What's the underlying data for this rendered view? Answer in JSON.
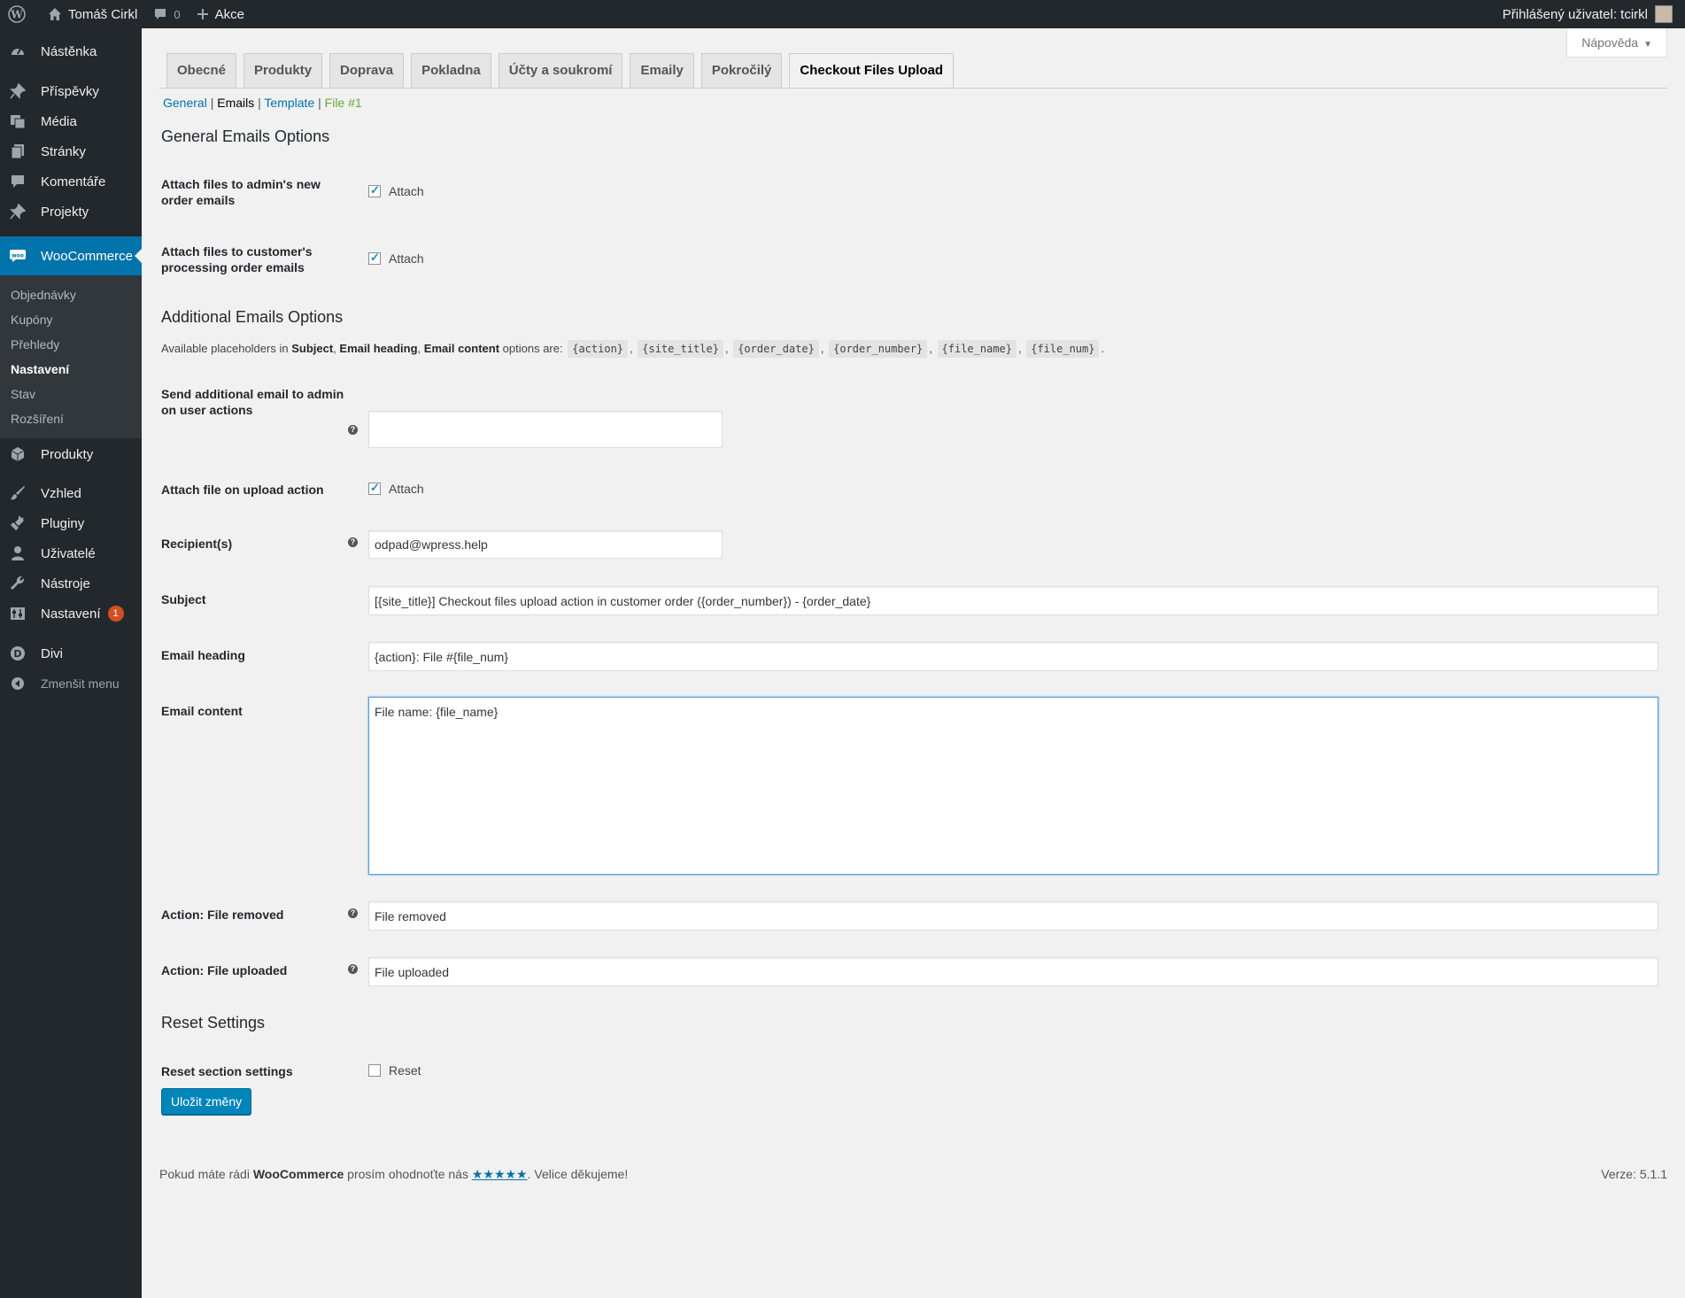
{
  "adminbar": {
    "site_name": "Tomáš Cirkl",
    "comments_count": "0",
    "new_label": "Akce",
    "user_greeting": "Přihlášený uživatel: tcirkl"
  },
  "sidebar": {
    "items": [
      {
        "label": "Nástěnka",
        "icon": "dashboard-icon"
      },
      {
        "label": "Příspěvky",
        "icon": "pin-icon"
      },
      {
        "label": "Média",
        "icon": "media-icon"
      },
      {
        "label": "Stránky",
        "icon": "pages-icon"
      },
      {
        "label": "Komentáře",
        "icon": "comment-icon"
      },
      {
        "label": "Projekty",
        "icon": "pin-icon"
      },
      {
        "label": "WooCommerce",
        "icon": "woo-icon"
      },
      {
        "label": "Produkty",
        "icon": "box-icon"
      },
      {
        "label": "Vzhled",
        "icon": "brush-icon"
      },
      {
        "label": "Pluginy",
        "icon": "plugin-icon"
      },
      {
        "label": "Uživatelé",
        "icon": "user-icon"
      },
      {
        "label": "Nástroje",
        "icon": "wrench-icon"
      },
      {
        "label": "Nastavení",
        "icon": "settings-icon",
        "badge": "1"
      },
      {
        "label": "Divi",
        "icon": "divi-icon"
      },
      {
        "label": "Zmenšit menu",
        "icon": "collapse-icon"
      }
    ],
    "woo_submenu": [
      "Objednávky",
      "Kupóny",
      "Přehledy",
      "Nastavení",
      "Stav",
      "Rozšíření"
    ]
  },
  "help_tab": "Nápověda",
  "tabs": [
    "Obecné",
    "Produkty",
    "Doprava",
    "Pokladna",
    "Účty a soukromí",
    "Emaily",
    "Pokročilý",
    "Checkout Files Upload"
  ],
  "subnav": {
    "general": "General",
    "emails": "Emails",
    "template": "Template",
    "file1": "File #1"
  },
  "sections": {
    "general": "General Emails Options",
    "additional": "Additional Emails Options",
    "reset": "Reset Settings"
  },
  "fields": {
    "attach_admin": {
      "label": "Attach files to admin's new order emails",
      "option": "Attach",
      "checked": true
    },
    "attach_customer": {
      "label": "Attach files to customer's processing order emails",
      "option": "Attach",
      "checked": true
    },
    "send_additional": {
      "label": "Send additional email to admin on user actions",
      "value": ""
    },
    "attach_upload": {
      "label": "Attach file on upload action",
      "option": "Attach",
      "checked": true
    },
    "recipients": {
      "label": "Recipient(s)",
      "value": "odpad@wpress.help"
    },
    "subject": {
      "label": "Subject",
      "value": "[{site_title}] Checkout files upload action in customer order ({order_number}) - {order_date}"
    },
    "heading": {
      "label": "Email heading",
      "value": "{action}: File #{file_num}"
    },
    "content": {
      "label": "Email content",
      "value": "File name: {file_name}"
    },
    "action_removed": {
      "label": "Action: File removed",
      "value": "File removed"
    },
    "action_uploaded": {
      "label": "Action: File uploaded",
      "value": "File uploaded"
    },
    "reset": {
      "label": "Reset section settings",
      "option": "Reset",
      "checked": false
    }
  },
  "placeholders": {
    "prefix": "Available placeholders in",
    "subject": "Subject",
    "heading": "Email heading",
    "content": "Email content",
    "suffix": "options are:",
    "codes": [
      "{action}",
      "{site_title}",
      "{order_date}",
      "{order_number}",
      "{file_name}",
      "{file_num}"
    ]
  },
  "save_label": "Uložit změny",
  "footer": {
    "text_before": "Pokud máte rádi",
    "brand": "WooCommerce",
    "text_mid": "prosím ohodnoťte nás",
    "stars": "★★★★★",
    "text_after": ". Velice děkujeme!",
    "version": "Verze: 5.1.1"
  },
  "colors": {
    "accent": "#0073aa",
    "sidebar": "#23282d",
    "badge": "#d54e21"
  }
}
